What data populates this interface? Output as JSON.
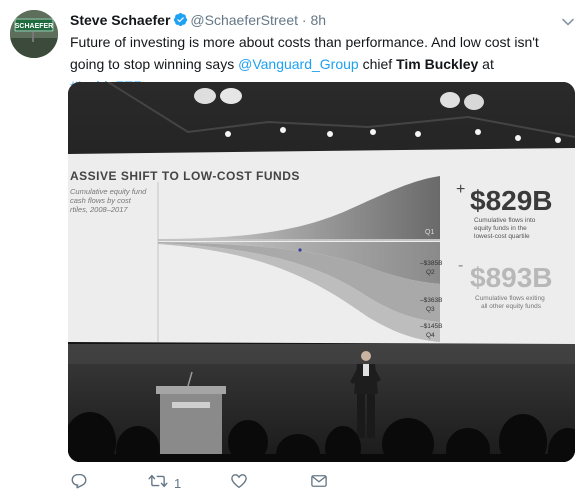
{
  "tweet": {
    "author_name": "Steve Schaefer",
    "handle": "@SchaeferStreet",
    "separator": "·",
    "time": "8h",
    "text_part1": "Future of investing is more about costs than performance. And low cost isn't going to stop winning says ",
    "mention": "@Vanguard_Group",
    "text_part2": " chief ",
    "bold_name": "Tim Buckley",
    "text_part3": " at ",
    "hashtag": "#InsideETFs",
    "retweet_count": "1",
    "avatar_sign_text": "SCHAEFER"
  },
  "slide": {
    "title": "ASSIVE SHIFT TO LOW-COST FUNDS",
    "subtitle_lines": [
      "Cumulative equity fund",
      "cash flows by cost",
      "rtiles, 2008–2017"
    ],
    "plus_sign": "+",
    "top_amount": "$829B",
    "top_caption_lines": [
      "Cumulative flows into",
      "equity funds in the",
      "lowest-cost quartile"
    ],
    "q1_label": "Q1",
    "minus_sign": "-",
    "bottom_amount": "$893B",
    "bottom_caption_lines": [
      "Cumulative flows exiting",
      "all other equity funds"
    ],
    "q2_value": "–$385B",
    "q2_label": "Q2",
    "q3_value": "–$363B",
    "q3_label": "Q3",
    "q4_value": "–$145B",
    "q4_label": "Q4"
  },
  "colors": {
    "link": "#1da1f2",
    "secondary_text": "#657786",
    "verified_badge": "#1da1f2"
  },
  "icons": [
    "verified-icon",
    "chevron-down-icon",
    "reply-icon",
    "retweet-icon",
    "like-icon",
    "direct-message-icon"
  ]
}
